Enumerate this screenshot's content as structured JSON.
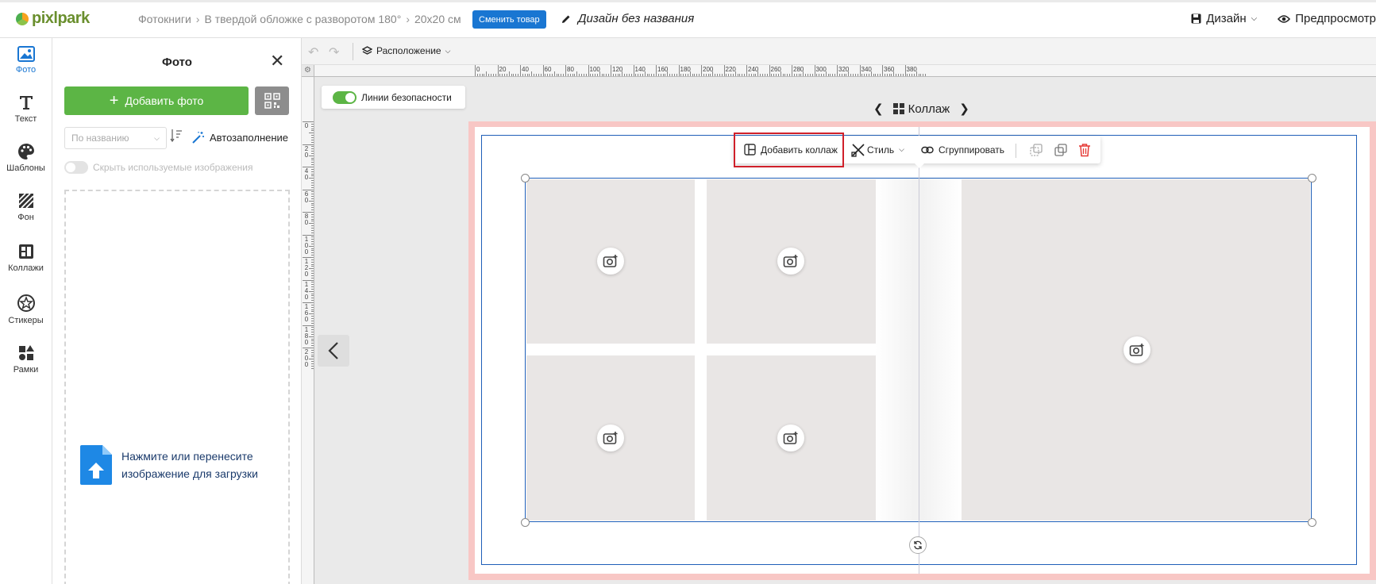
{
  "header": {
    "logo_text": "pixlpark",
    "breadcrumbs": [
      "Фотокниги",
      "В твердой обложке с разворотом 180°",
      "20x20 см"
    ],
    "change_product_label": "Сменить товар",
    "design_name": "Дизайн без названия",
    "design_menu_label": "Дизайн",
    "preview_label": "Предпросмотр"
  },
  "rail": {
    "items": [
      {
        "label": "Фото",
        "icon": "photo-icon",
        "active": true
      },
      {
        "label": "Текст",
        "icon": "text-icon"
      },
      {
        "label": "Шаблоны",
        "icon": "palette-icon"
      },
      {
        "label": "Фон",
        "icon": "background-icon"
      },
      {
        "label": "Коллажи",
        "icon": "collage-icon"
      },
      {
        "label": "Стикеры",
        "icon": "sticker-icon"
      },
      {
        "label": "Рамки",
        "icon": "frames-icon"
      }
    ]
  },
  "panel": {
    "title": "Фото",
    "add_photo_label": "Добавить фото",
    "sort_placeholder": "По названию",
    "autofill_label": "Автозаполнение",
    "hide_used_label": "Скрыть используемые изображения",
    "dropzone_text": "Нажмите или перенесите изображение для загрузки"
  },
  "toolbar": {
    "arrange_label": "Расположение",
    "safety_lines_label": "Линии безопасности"
  },
  "ruler": {
    "h_labels": [
      "0",
      "20",
      "40",
      "60",
      "80",
      "100",
      "120",
      "140",
      "160",
      "180",
      "200",
      "220",
      "240",
      "260",
      "280",
      "300",
      "320",
      "340",
      "360",
      "380"
    ],
    "v_labels": [
      "0",
      "20",
      "40",
      "60",
      "80",
      "100",
      "120",
      "140",
      "160",
      "180",
      "200"
    ]
  },
  "canvas": {
    "page_nav_label": "Коллаж"
  },
  "context_toolbar": {
    "add_collage_label": "Добавить коллаж",
    "style_label": "Стиль",
    "group_label": "Сгруппировать"
  },
  "colors": {
    "accent_blue": "#1976d2",
    "green": "#5cb545",
    "spread_border": "#f8c7c5",
    "highlight_red": "#d0202a",
    "delete_red": "#e53935"
  }
}
